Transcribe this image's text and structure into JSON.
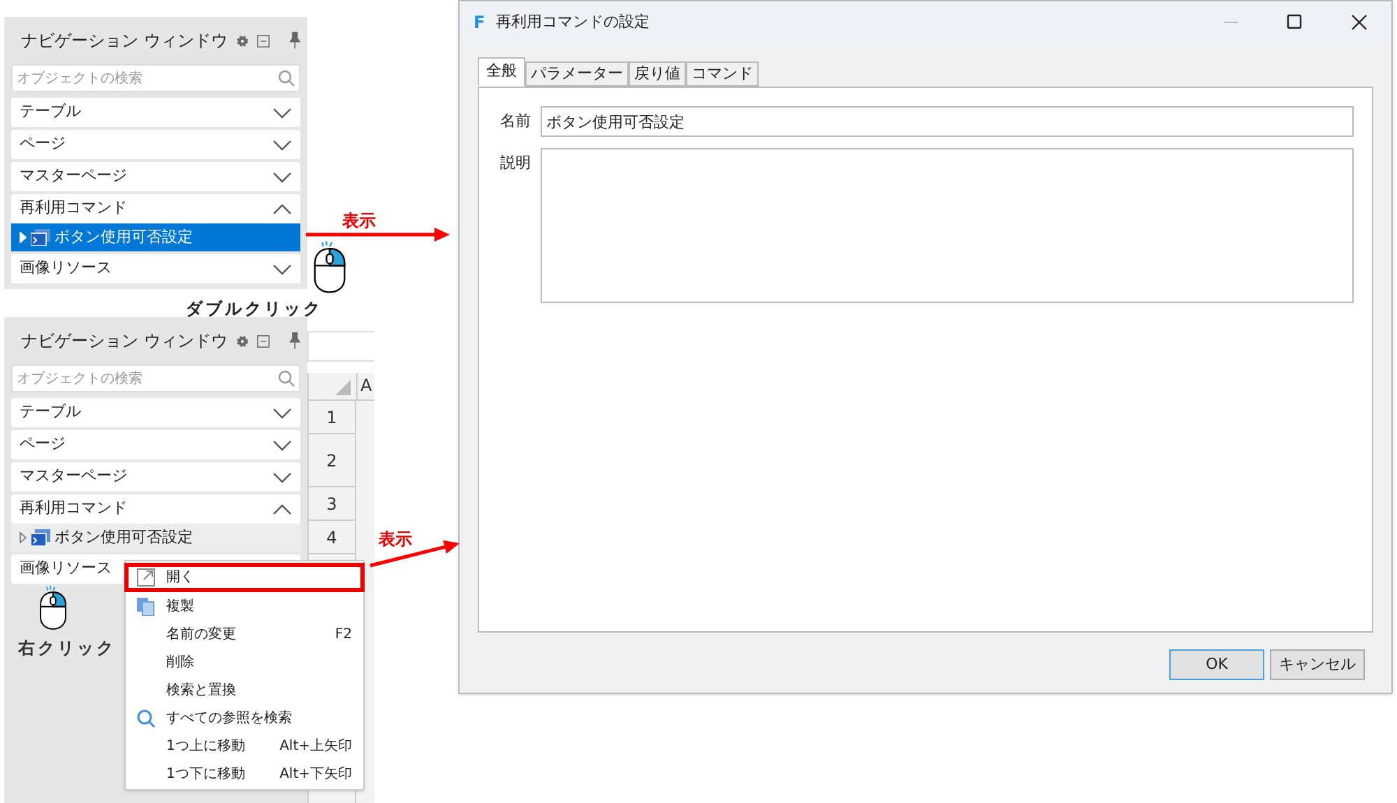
{
  "nav_panels": [
    {
      "title": "ナビゲーション ウィンドウ",
      "search": {
        "placeholder": "オブジェクトの検索"
      },
      "sections": [
        {
          "label": "テーブル",
          "expanded": false
        },
        {
          "label": "ページ",
          "expanded": false
        },
        {
          "label": "マスターページ",
          "expanded": false
        },
        {
          "label": "再利用コマンド",
          "expanded": true,
          "children": [
            {
              "label": "ボタン使用可否設定",
              "selected": true
            }
          ]
        },
        {
          "label": "画像リソース",
          "expanded": false
        }
      ],
      "gesture": "ダブルクリック",
      "annotation": "表示"
    },
    {
      "title": "ナビゲーション ウィンドウ",
      "search": {
        "placeholder": "オブジェクトの検索"
      },
      "sections": [
        {
          "label": "テーブル",
          "expanded": false
        },
        {
          "label": "ページ",
          "expanded": false
        },
        {
          "label": "マスターページ",
          "expanded": false
        },
        {
          "label": "再利用コマンド",
          "expanded": true,
          "children": [
            {
              "label": "ボタン使用可否設定",
              "selected": false
            }
          ]
        },
        {
          "label": "画像リソース"
        }
      ],
      "gesture": "右クリック",
      "annotation": "表示",
      "sheet": {
        "column": "A",
        "rows": [
          "1",
          "2",
          "3",
          "4"
        ]
      },
      "context_menu": [
        {
          "label": "開く",
          "kind": "open",
          "highlighted": true
        },
        {
          "label": "複製",
          "kind": "copy",
          "highlighted": false
        },
        {
          "label": "名前の変更",
          "shortcut": "F2",
          "highlighted": false
        },
        {
          "label": "削除",
          "highlighted": false
        },
        {
          "label": "検索と置換",
          "highlighted": false
        },
        {
          "label": "すべての参照を検索",
          "kind": "search",
          "highlighted": false
        },
        {
          "label": "1つ上に移動",
          "shortcut": "Alt+上矢印",
          "highlighted": false
        },
        {
          "label": "1つ下に移動",
          "shortcut": "Alt+下矢印",
          "highlighted": false
        }
      ]
    }
  ],
  "dialog": {
    "logo": "F",
    "title": "再利用コマンドの設定",
    "tabs": [
      {
        "label": "全般",
        "selected": true
      },
      {
        "label": "パラメーター",
        "selected": false
      },
      {
        "label": "戻り値",
        "selected": false
      },
      {
        "label": "コマンド",
        "selected": false
      }
    ],
    "fields": [
      {
        "label": "名前",
        "value": "ボタン使用可否設定",
        "kind": "text"
      },
      {
        "label": "説明",
        "kind": "textarea"
      }
    ],
    "buttons": [
      {
        "label": "OK",
        "default": true
      },
      {
        "label": "キャンセル",
        "default": false
      }
    ]
  }
}
